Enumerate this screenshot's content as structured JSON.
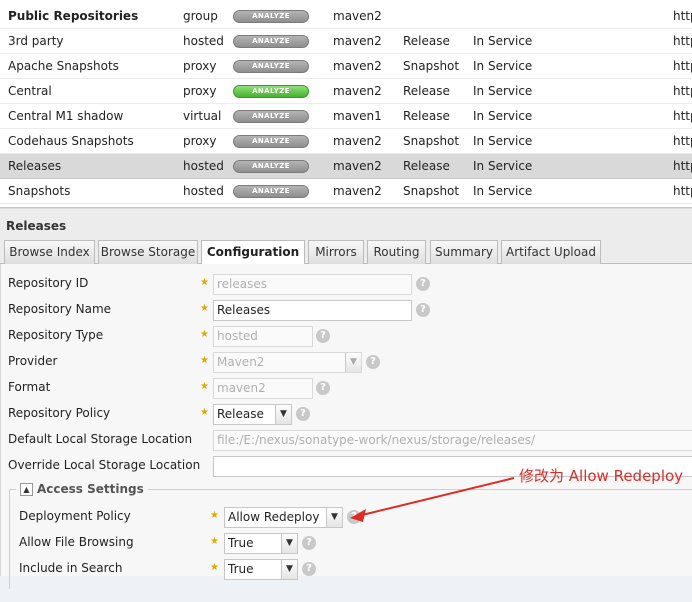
{
  "repositories": [
    {
      "name": "Public Repositories",
      "type": "group",
      "health": "ANALYZE",
      "format": "maven2",
      "policy": "",
      "status": "",
      "url": "http",
      "bold": true
    },
    {
      "name": "3rd party",
      "type": "hosted",
      "health": "ANALYZE",
      "format": "maven2",
      "policy": "Release",
      "status": "In Service",
      "url": "http"
    },
    {
      "name": "Apache Snapshots",
      "type": "proxy",
      "health": "ANALYZE",
      "format": "maven2",
      "policy": "Snapshot",
      "status": "In Service",
      "url": "http"
    },
    {
      "name": "Central",
      "type": "proxy",
      "health": "ANALYZE",
      "format": "maven2",
      "policy": "Release",
      "status": "In Service",
      "url": "http",
      "green": true
    },
    {
      "name": "Central M1 shadow",
      "type": "virtual",
      "health": "ANALYZE",
      "format": "maven1",
      "policy": "Release",
      "status": "In Service",
      "url": "http"
    },
    {
      "name": "Codehaus Snapshots",
      "type": "proxy",
      "health": "ANALYZE",
      "format": "maven2",
      "policy": "Snapshot",
      "status": "In Service",
      "url": "http"
    },
    {
      "name": "Releases",
      "type": "hosted",
      "health": "ANALYZE",
      "format": "maven2",
      "policy": "Release",
      "status": "In Service",
      "url": "http",
      "selected": true
    },
    {
      "name": "Snapshots",
      "type": "hosted",
      "health": "ANALYZE",
      "format": "maven2",
      "policy": "Snapshot",
      "status": "In Service",
      "url": "http"
    }
  ],
  "detail": {
    "title": "Releases",
    "tabs": [
      "Browse Index",
      "Browse Storage",
      "Configuration",
      "Mirrors",
      "Routing",
      "Summary",
      "Artifact Upload"
    ],
    "active_tab": "Configuration"
  },
  "form": {
    "repository_id": {
      "label": "Repository ID",
      "value": "releases"
    },
    "repository_name": {
      "label": "Repository Name",
      "value": "Releases"
    },
    "repository_type": {
      "label": "Repository Type",
      "value": "hosted"
    },
    "provider": {
      "label": "Provider",
      "value": "Maven2"
    },
    "format": {
      "label": "Format",
      "value": "maven2"
    },
    "repository_policy": {
      "label": "Repository Policy",
      "value": "Release"
    },
    "default_storage": {
      "label": "Default Local Storage Location",
      "value": "file:/E:/nexus/sonatype-work/nexus/storage/releases/"
    },
    "override_storage": {
      "label": "Override Local Storage Location",
      "value": ""
    },
    "help_glyph": "?",
    "required_glyph": "★"
  },
  "access_settings": {
    "legend": "Access Settings",
    "toggle_glyph": "▲",
    "deployment_policy": {
      "label": "Deployment Policy",
      "value": "Allow Redeploy"
    },
    "allow_file_browsing": {
      "label": "Allow File Browsing",
      "value": "True"
    },
    "include_in_search": {
      "label": "Include in Search",
      "value": "True"
    }
  },
  "annotation": {
    "text": "修改为 Allow Redeploy",
    "color": "#e02a24"
  }
}
